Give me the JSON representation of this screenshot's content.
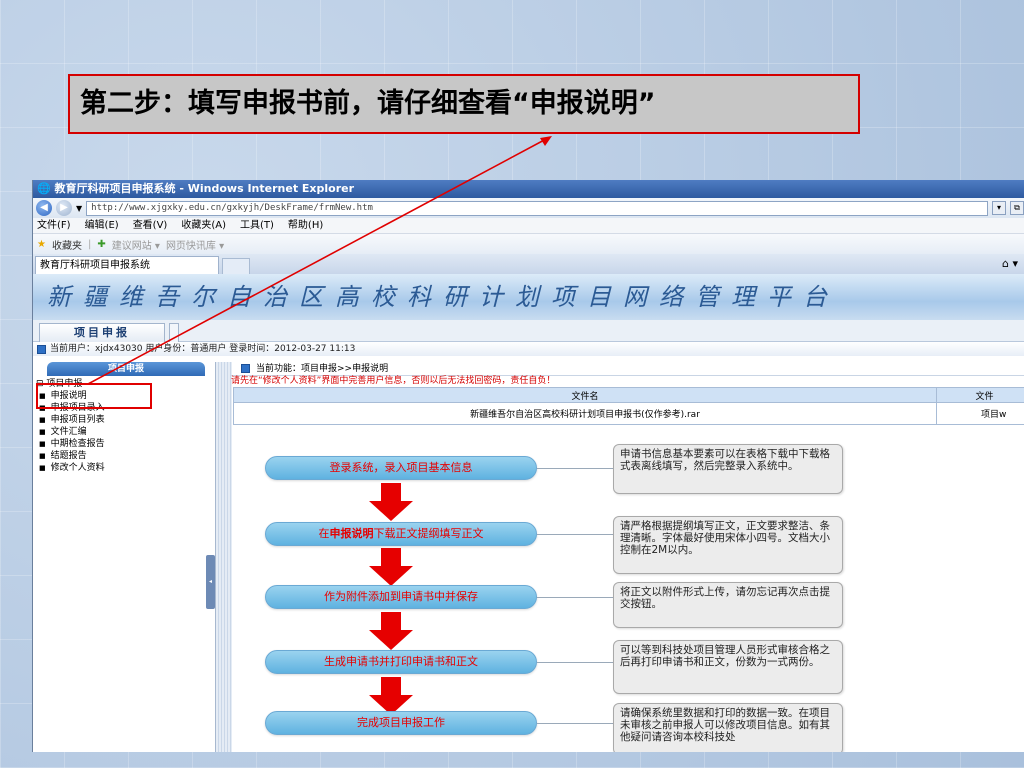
{
  "callout": {
    "text": "第二步：填写申报书前，请仔细查看“申报说明”"
  },
  "browser": {
    "title": "教育厅科研项目申报系统 - Windows Internet Explorer",
    "url": "http://www.xjgxky.edu.cn/gxkyjh/DeskFrame/frmNew.htm",
    "menu": [
      "文件(F)",
      "编辑(E)",
      "查看(V)",
      "收藏夹(A)",
      "工具(T)",
      "帮助(H)"
    ],
    "favorites": "收藏夹",
    "suggested_sites": "建议网站 ▾",
    "web_slices": "网页快讯库 ▾",
    "tab_label": "教育厅科研项目申报系统"
  },
  "app": {
    "banner": "新疆维吾尔自治区高校科研计划项目网络管理平台",
    "nav_tab": "项目申报",
    "user_bar": "当前用户：xjdx43030 用户身份：普通用户 登录时间：2012-03-27 11:13",
    "sidebar": {
      "header": "项目申报",
      "root": "项目申报",
      "items": [
        "申报说明",
        "申报项目录入",
        "申报项目列表",
        "文件汇编",
        "中期检查报告",
        "结题报告",
        "修改个人资料"
      ]
    },
    "current_function": "当前功能：项目申报>>申报说明",
    "warning": "请先在“修改个人资料”界面中完善用户信息，否则以后无法找回密码，责任自负！",
    "file_table": {
      "headers": [
        "文件名",
        "文件"
      ],
      "rows": [
        [
          "新疆维吾尔自治区高校科研计划项目申报书(仅作参考).rar",
          "项目w"
        ]
      ]
    },
    "steps": [
      {
        "pre": "登录系统，录入项目基本信息",
        "bold": "",
        "post": ""
      },
      {
        "pre": "在",
        "bold": "申报说明",
        "post": "下载正文提纲填写正文"
      },
      {
        "pre": "作为附件添加到申请书中并保存",
        "bold": "",
        "post": ""
      },
      {
        "pre": "生成申请书并打印申请书和正文",
        "bold": "",
        "post": ""
      },
      {
        "pre": "完成项目申报工作",
        "bold": "",
        "post": ""
      }
    ],
    "notes": [
      {
        "text": "申请书信息基本要素可以在表格下载中下载格式表离线填写，然后完整录入系统中。"
      },
      {
        "text": "请严格根据提纲填写正文，正文要求整洁、条理清晰。字体最好使用宋体小四号。文档大小控制在2M以内。"
      },
      {
        "text": "将正文以附件形式上传，请勿忘记再次点击提交按钮。"
      },
      {
        "text": "可以等到科技处项目管理人员形式审核合格之后再打印申请书和正文，份数为一式两份。"
      },
      {
        "text": "请确保系统里数据和打印的数据一致。在项目未审核之前申报人可以修改项目信息。如有其他疑问请咨询本校科技处"
      }
    ]
  },
  "colors": {
    "accent_red": "#d40000",
    "step_fill": "#7cc4ea",
    "arrow_red": "#e60000"
  }
}
